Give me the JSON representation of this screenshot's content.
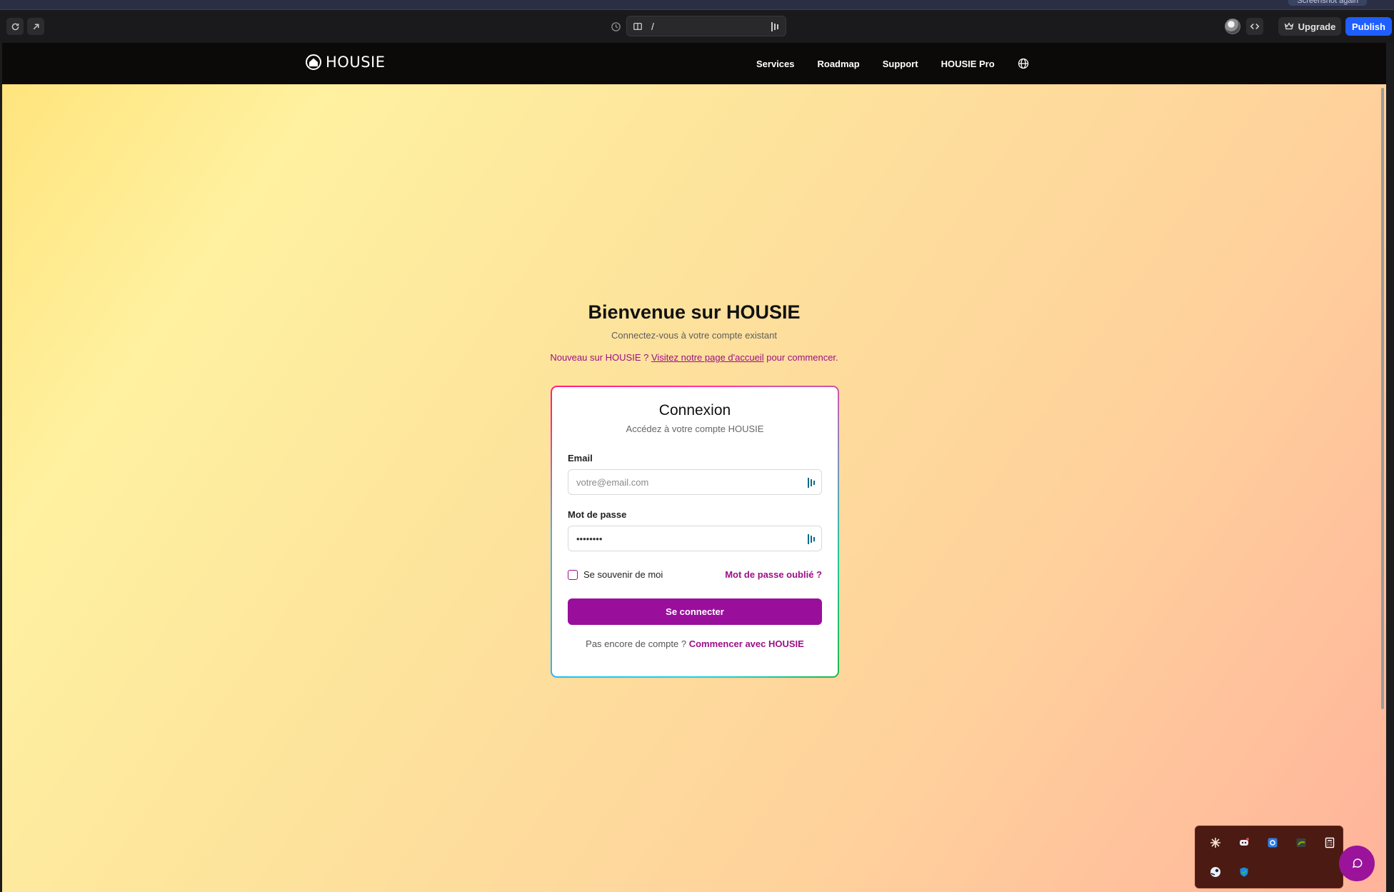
{
  "editor": {
    "top_pill": "Screenshot again",
    "address": "/",
    "upgrade_label": "Upgrade",
    "publish_label": "Publish"
  },
  "site_nav": {
    "brand": "HOUSIE",
    "links": [
      "Services",
      "Roadmap",
      "Support",
      "HOUSIE Pro"
    ]
  },
  "hero": {
    "title": "Bienvenue sur HOUSIE",
    "subtitle": "Connectez-vous à votre compte existant",
    "new_prefix": "Nouveau sur HOUSIE ?",
    "new_link": "Visitez notre page d'accueil",
    "new_suffix": "pour commencer."
  },
  "login_card": {
    "title": "Connexion",
    "subtitle": "Accédez à votre compte HOUSIE",
    "email_label": "Email",
    "email_placeholder": "votre@email.com",
    "password_label": "Mot de passe",
    "password_value": "••••••••",
    "remember_label": "Se souvenir de moi",
    "forgot_label": "Mot de passe oublié ?",
    "submit_label": "Se connecter",
    "signup_prefix": "Pas encore de compte ?",
    "signup_link": "Commencer avec HOUSIE"
  },
  "colors": {
    "accent": "#990f9c",
    "publish": "#1f5eff"
  }
}
